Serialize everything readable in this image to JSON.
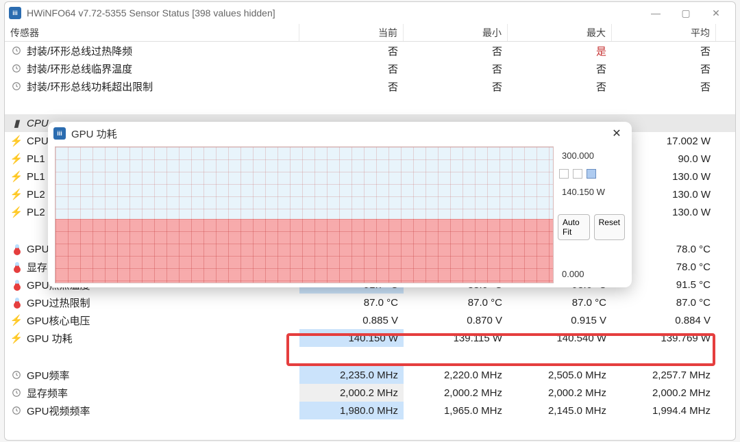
{
  "window": {
    "title": "HWiNFO64 v7.72-5355 Sensor Status [398 values hidden]"
  },
  "columns": {
    "sensor": "传感器",
    "current": "当前",
    "min": "最小",
    "max": "最大",
    "avg": "平均"
  },
  "rows": {
    "thermal_throttle": {
      "label": "封装/环形总线过热降频",
      "cur": "否",
      "min": "否",
      "max": "是",
      "avg": "否",
      "max_red": true
    },
    "thermal_limit": {
      "label": "封装/环形总线临界温度",
      "cur": "否",
      "min": "否",
      "max": "否",
      "avg": "否"
    },
    "power_limit": {
      "label": "封装/环形总线功耗超出限制",
      "cur": "否",
      "min": "否",
      "max": "否",
      "avg": "否"
    },
    "section_cpu": {
      "label": "CPU"
    },
    "cpu": {
      "label": "CPU",
      "avg": "17.002 W"
    },
    "pl11": {
      "label": "PL1",
      "avg": "90.0 W"
    },
    "pl12": {
      "label": "PL1",
      "avg": "130.0 W"
    },
    "pl21": {
      "label": "PL2",
      "avg": "130.0 W"
    },
    "pl22": {
      "label": "PL2",
      "avg": "130.0 W"
    },
    "gpu_temp": {
      "label": "GPU",
      "avg": "78.0 °C"
    },
    "mem_temp": {
      "label": "显存",
      "avg": "78.0 °C"
    },
    "gpu_hot": {
      "label": "GPU热点温度",
      "cur": "91.7 °C",
      "min": "88.0 °C",
      "max": "93.6 °C",
      "avg": "91.5 °C"
    },
    "gpu_over": {
      "label": "GPU过热限制",
      "cur": "87.0 °C",
      "min": "87.0 °C",
      "max": "87.0 °C",
      "avg": "87.0 °C"
    },
    "gpu_vcore": {
      "label": "GPU核心电压",
      "cur": "0.885 V",
      "min": "0.870 V",
      "max": "0.915 V",
      "avg": "0.884 V"
    },
    "gpu_power": {
      "label": "GPU 功耗",
      "cur": "140.150 W",
      "min": "139.115 W",
      "max": "140.540 W",
      "avg": "139.769 W"
    },
    "gpu_clock": {
      "label": "GPU频率",
      "cur": "2,235.0 MHz",
      "min": "2,220.0 MHz",
      "max": "2,505.0 MHz",
      "avg": "2,257.7 MHz"
    },
    "mem_clock": {
      "label": "显存频率",
      "cur": "2,000.2 MHz",
      "min": "2,000.2 MHz",
      "max": "2,000.2 MHz",
      "avg": "2,000.2 MHz"
    },
    "gpu_video": {
      "label": "GPU视频频率",
      "cur": "1,980.0 MHz",
      "min": "1,965.0 MHz",
      "max": "2,145.0 MHz",
      "avg": "1,994.4 MHz"
    }
  },
  "popup": {
    "title": "GPU 功耗",
    "top_label": "300.000",
    "value_label": "140.150 W",
    "bottom_label": "0.000",
    "auto_fit": "Auto Fit",
    "reset": "Reset"
  }
}
